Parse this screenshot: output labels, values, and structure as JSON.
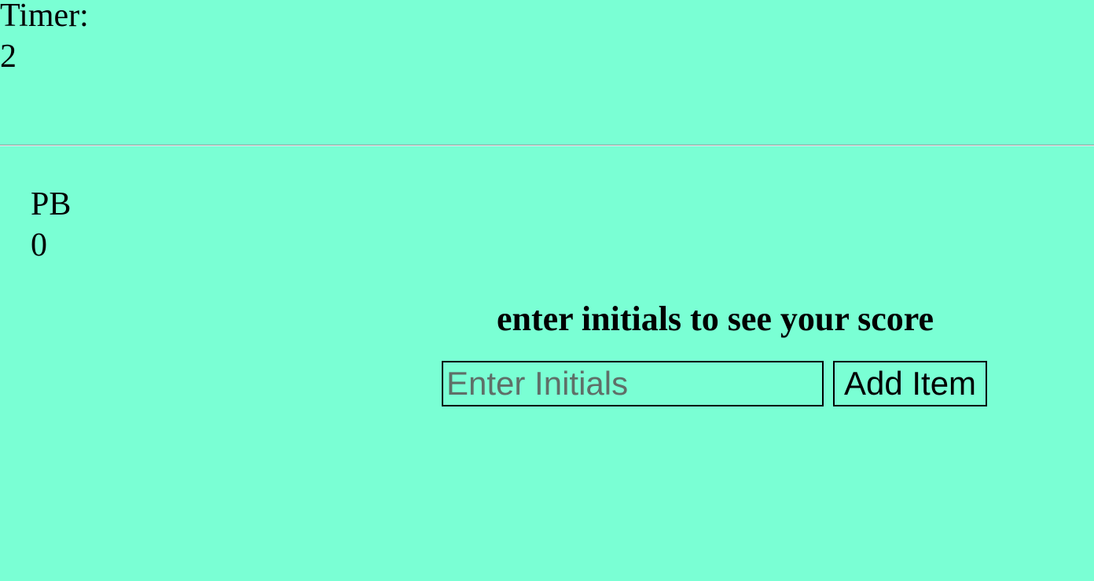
{
  "timer": {
    "label": "Timer:",
    "value": "2"
  },
  "personal_best": {
    "label": "PB",
    "value": "0"
  },
  "score_form": {
    "prompt": "enter initials to see your score",
    "input_value": "",
    "input_placeholder": "Enter Initials",
    "submit_label": "Add Item"
  },
  "colors": {
    "background": "#7affd4",
    "text": "#000000"
  }
}
